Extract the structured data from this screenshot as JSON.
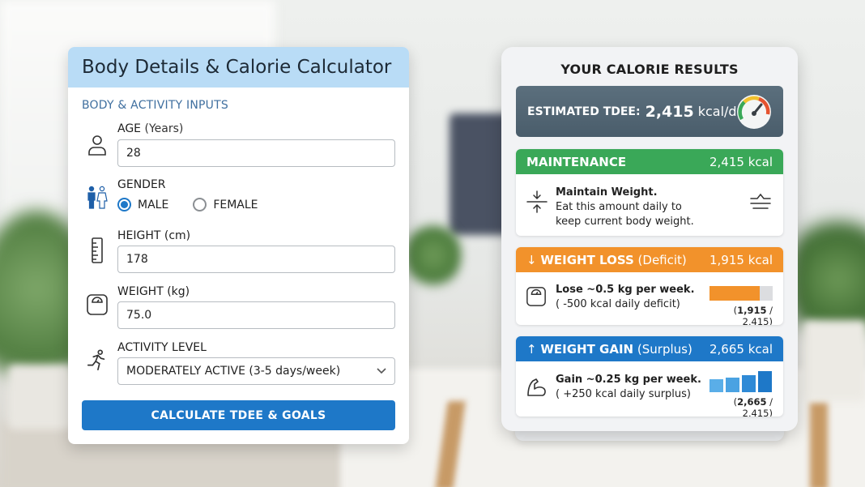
{
  "calculator": {
    "title": "Body Details & Calorie Calculator",
    "section_label": "BODY & ACTIVITY INPUTS",
    "age": {
      "label": "AGE",
      "unit": "(Years)",
      "value": "28"
    },
    "gender": {
      "label": "GENDER",
      "options": [
        "MALE",
        "FEMALE"
      ],
      "selected": "MALE"
    },
    "height": {
      "label": "HEIGHT (cm)",
      "value": "178"
    },
    "weight": {
      "label": "WEIGHT (kg)",
      "value": "75.0"
    },
    "activity": {
      "label": "ACTIVITY LEVEL",
      "value": "MODERATELY ACTIVE (3-5 days/week)"
    },
    "button_label": "CALCULATE TDEE & GOALS"
  },
  "results": {
    "title": "YOUR CALORIE RESULTS",
    "tdee": {
      "label": "ESTIMATED TDEE:",
      "value": "2,415",
      "unit": "kcal/day"
    },
    "maintenance": {
      "name": "MAINTENANCE",
      "kcal": "2,415 kcal",
      "headline": "Maintain Weight.",
      "detail": "Eat this amount daily to keep current body weight.",
      "color": "#3aa858"
    },
    "loss": {
      "arrow": "↓",
      "name": "WEIGHT LOSS",
      "sub": "(Deficit)",
      "kcal": "1,915 kcal",
      "headline": "Lose ~0.5 kg per week.",
      "detail": "( -500 kcal daily deficit)",
      "meter_value": "1,915",
      "meter_total": "/ 2,415)",
      "meter_open": "(",
      "fill_fraction": 0.79,
      "color": "#f2922b"
    },
    "gain": {
      "arrow": "↑",
      "name": "WEIGHT GAIN",
      "sub": "(Surplus)",
      "kcal": "2,665 kcal",
      "headline": "Gain ~0.25 kg per week.",
      "detail": "( +250 kcal daily surplus)",
      "meter_value": "2,665",
      "meter_total": "/ 2,415)",
      "meter_open": "(",
      "color": "#1e78c8"
    }
  }
}
